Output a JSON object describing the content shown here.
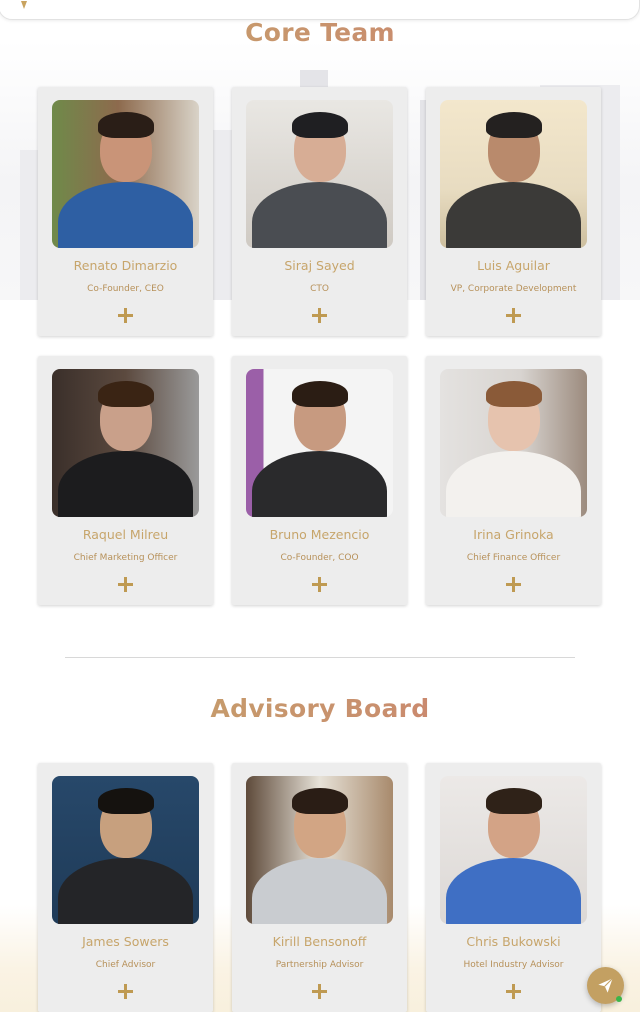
{
  "sections": {
    "core_team_title": "Core Team",
    "advisory_board_title": "Advisory Board"
  },
  "core_team": [
    {
      "name": "Renato Dimarzio",
      "role": "Co-Founder, CEO"
    },
    {
      "name": "Siraj Sayed",
      "role": "CTO"
    },
    {
      "name": "Luis Aguilar",
      "role": "VP, Corporate Development"
    },
    {
      "name": "Raquel Milreu",
      "role": "Chief Marketing Officer"
    },
    {
      "name": "Bruno Mezencio",
      "role": "Co-Founder, COO"
    },
    {
      "name": "Irina Grinoka",
      "role": "Chief Finance Officer"
    }
  ],
  "advisory_board": [
    {
      "name": "James Sowers",
      "role": "Chief Advisor"
    },
    {
      "name": "Kirill Bensonoff",
      "role": "Partnership Advisor"
    },
    {
      "name": "Chris Bukowski",
      "role": "Hotel Industry Advisor"
    }
  ],
  "icons": {
    "expand": "plus-icon",
    "chat": "send-icon"
  },
  "colors": {
    "accent_gold": "#c3a062",
    "title_gradient_start": "#c3a869",
    "title_gradient_end": "#cf6f72",
    "card_bg": "#ededed"
  }
}
